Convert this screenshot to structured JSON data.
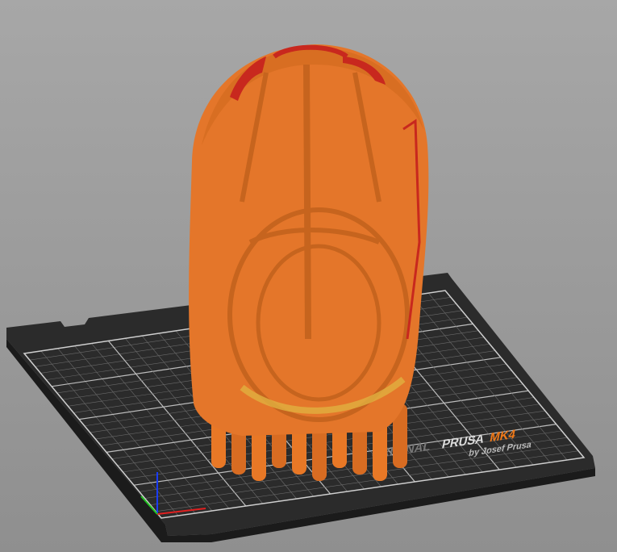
{
  "scene": {
    "bed_logo": {
      "original": "ORIGINAL",
      "prusa": "PRUSA",
      "model": "MK4",
      "byline": "by Josef Prusa"
    },
    "colors": {
      "filament": "#e87826",
      "overhang": "#c8281e",
      "bed": "#2a2a2a",
      "grid": "#9a9a9a",
      "background": "#9c9c9c",
      "logo_accent": "#f07a1a"
    }
  }
}
